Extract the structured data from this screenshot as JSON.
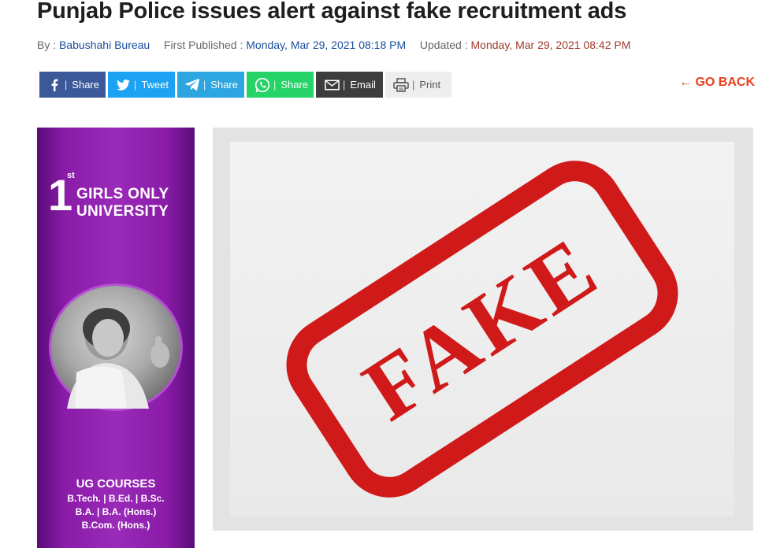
{
  "article": {
    "headline": "Punjab Police issues alert against fake recruitment ads",
    "by_label": "By :",
    "author": "Babushahi Bureau",
    "first_published_label": "First Published :",
    "first_published": "Monday, Mar 29, 2021 08:18 PM",
    "updated_label": "Updated :",
    "updated": "Monday, Mar 29, 2021 08:42 PM"
  },
  "share": {
    "separator": "|",
    "facebook": "Share",
    "twitter": "Tweet",
    "telegram": "Share",
    "whatsapp": "Share",
    "email": "Email",
    "print": "Print"
  },
  "nav": {
    "go_back": "← GO BACK"
  },
  "ad": {
    "rank": "1",
    "rank_suffix": "st",
    "title_line1": "GIRLS ONLY",
    "title_line2": "UNIVERSITY",
    "courses_title": "UG COURSES",
    "courses_line1": "B.Tech. | B.Ed. | B.Sc.",
    "courses_line2": "B.A. | B.A. (Hons.)",
    "courses_line3": "B.Com. (Hons.)"
  },
  "hero": {
    "stamp_text": "FAKE",
    "stamp_color": "#d01a1a"
  },
  "colors": {
    "facebook": "#3b5998",
    "twitter": "#1da1f2",
    "telegram": "#2ca5e0",
    "whatsapp": "#25d366",
    "email": "#3d3d3d",
    "go_back": "#e8401c"
  }
}
